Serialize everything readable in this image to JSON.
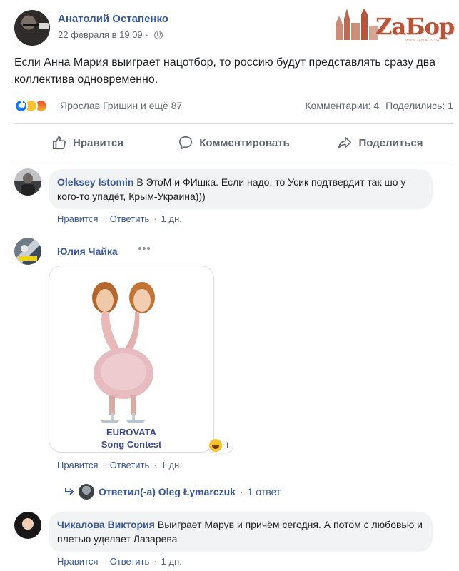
{
  "post": {
    "author": "Анатолий Остапенко",
    "date": "22 февраля в 19:09",
    "separator": "·",
    "text": "Если Анна Мария выиграет нацотбор, то россию будут представлять сразу два коллектива одновременно.",
    "reactors": "Ярослав Гришин и ещё 87",
    "comments_count": "Комментарии: 4",
    "shares_count": "Поделились: 1"
  },
  "watermark": {
    "text": "ZaБор",
    "subtext": "WWW.ZABOR.IN.UA"
  },
  "actions": {
    "like": "Нравится",
    "comment": "Комментировать",
    "share": "Поделиться"
  },
  "comment_actions": {
    "like": "Нравится",
    "reply": "Ответить",
    "dot": "·"
  },
  "comments": [
    {
      "name": "Oleksey Istomin",
      "text": "В ЭтоМ и ФИшка. Если надо, то Усик подтвердит так шо у кого-то упадёт, Крым-Украина)))",
      "time": "1 дн."
    },
    {
      "name": "Юлия Чайка",
      "image_caption_title": "EUROVATA",
      "image_caption_sub": "Song Contest",
      "reaction_count": "1",
      "time": "1 дн.",
      "reply": {
        "label": "Ответил(-а) Oleg Łymarczuk",
        "count": "1 ответ"
      }
    },
    {
      "name": "Чикалова Виктория",
      "text": "Выиграет Марув и причём сегодня. А потом с любовью и плетью уделает Лазарева",
      "time": "1 дн."
    }
  ],
  "colors": {
    "link": "#385898",
    "bubble": "#f2f3f5",
    "like_blue": "#1877f2",
    "watermark": "#b5553b"
  },
  "icons": [
    "globe-icon",
    "like-icon",
    "comment-icon",
    "share-icon",
    "reply-arrow-icon",
    "more-dots-icon",
    "haha-reaction-icon",
    "angry-reaction-icon"
  ]
}
